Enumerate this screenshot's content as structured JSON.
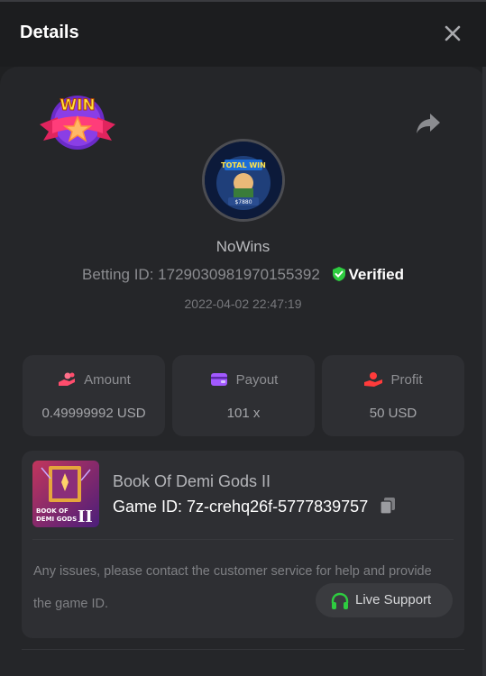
{
  "header": {
    "title": "Details"
  },
  "bet": {
    "username": "NoWins",
    "betting_id_label": "Betting ID:",
    "betting_id": "1729030981970155392",
    "verified_label": "Verified",
    "timestamp": "2022-04-02 22:47:19"
  },
  "badge": {
    "text": "WIN"
  },
  "stats": [
    {
      "label": "Amount",
      "value": "0.49999992 USD",
      "icon": "coins-hand-icon",
      "color": "#ff4d6d"
    },
    {
      "label": "Payout",
      "value": "101 x",
      "icon": "wallet-icon",
      "color": "#a259ff"
    },
    {
      "label": "Profit",
      "value": "50 USD",
      "icon": "money-hand-icon",
      "color": "#ff3b3b"
    }
  ],
  "game": {
    "name": "Book Of Demi Gods II",
    "id_label": "Game ID:",
    "id_value": "7z-crehq26f-5777839757",
    "thumb_text": "BOOK OF DEMI GODS II"
  },
  "support": {
    "notice": "Any issues, please contact the customer service for help and provide the game ID.",
    "button_label": "Live Support"
  },
  "colors": {
    "accent_green": "#2ecc40",
    "background": "#1f2022",
    "card": "#2e2f33"
  }
}
